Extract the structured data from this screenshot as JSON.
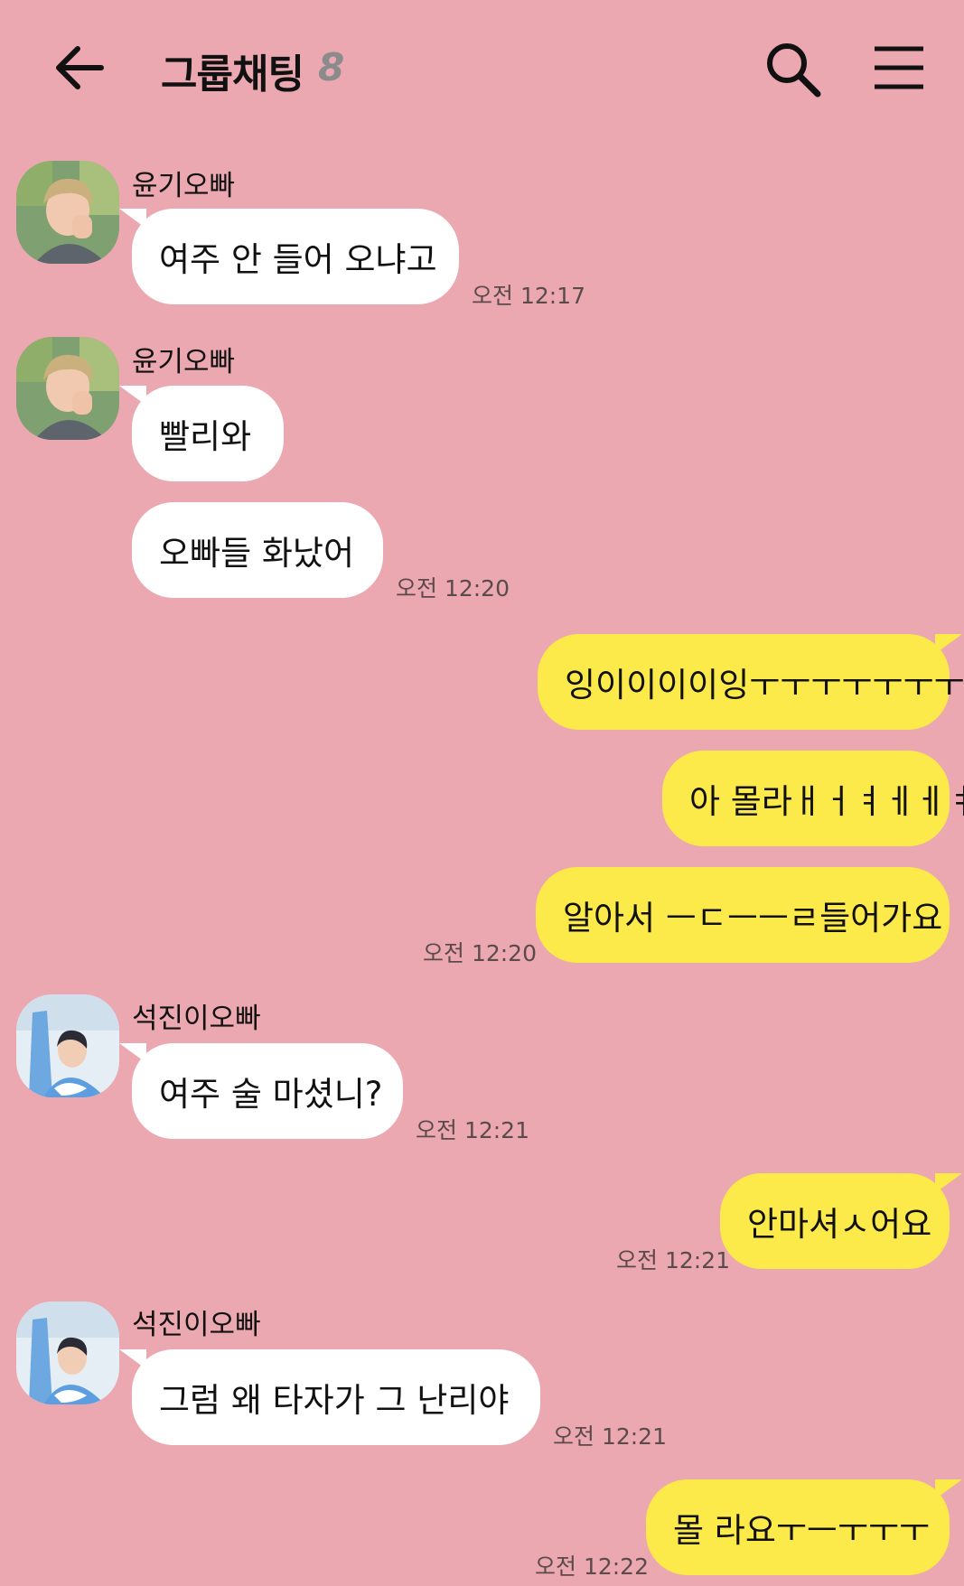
{
  "header": {
    "title": "그룹채팅",
    "member_count": "8"
  },
  "colors": {
    "background": "#eba8b0",
    "incoming_bubble": "#ffffff",
    "outgoing_bubble": "#fce94a"
  },
  "messages": [
    {
      "direction": "in",
      "sender": "윤기오빠",
      "avatar": "yoongi-avatar",
      "text": "여주 안 들어 오냐고",
      "time": "오전 12:17"
    },
    {
      "direction": "in",
      "sender": "윤기오빠",
      "avatar": "yoongi-avatar",
      "text": "빨리와",
      "time": ""
    },
    {
      "direction": "in",
      "sender": "",
      "avatar": "",
      "text": "오빠들 화났어",
      "time": "오전 12:20"
    },
    {
      "direction": "out",
      "text": "잉이이이이잉ㅜㅜㅜㅜㅜㅜㅜ",
      "time": ""
    },
    {
      "direction": "out",
      "text": "아 몰라ㅐㅓㅕㅔㅔㅕ",
      "time": ""
    },
    {
      "direction": "out",
      "text": "알아서 ㅡㄷㅡㅡㄹ들어가요",
      "time": "오전 12:20"
    },
    {
      "direction": "in",
      "sender": "석진이오빠",
      "avatar": "seokjin-avatar",
      "text": "여주 술 마셨니?",
      "time": "오전 12:21"
    },
    {
      "direction": "out",
      "text": "안마셔ㅅ어요",
      "time": "오전 12:21"
    },
    {
      "direction": "in",
      "sender": "석진이오빠",
      "avatar": "seokjin-avatar",
      "text": "그럼 왜 타자가 그 난리야",
      "time": "오전 12:21"
    },
    {
      "direction": "out",
      "text": "몰 라요ㅜㅡㅜㅜㅜ",
      "time": "오전 12:22"
    }
  ]
}
